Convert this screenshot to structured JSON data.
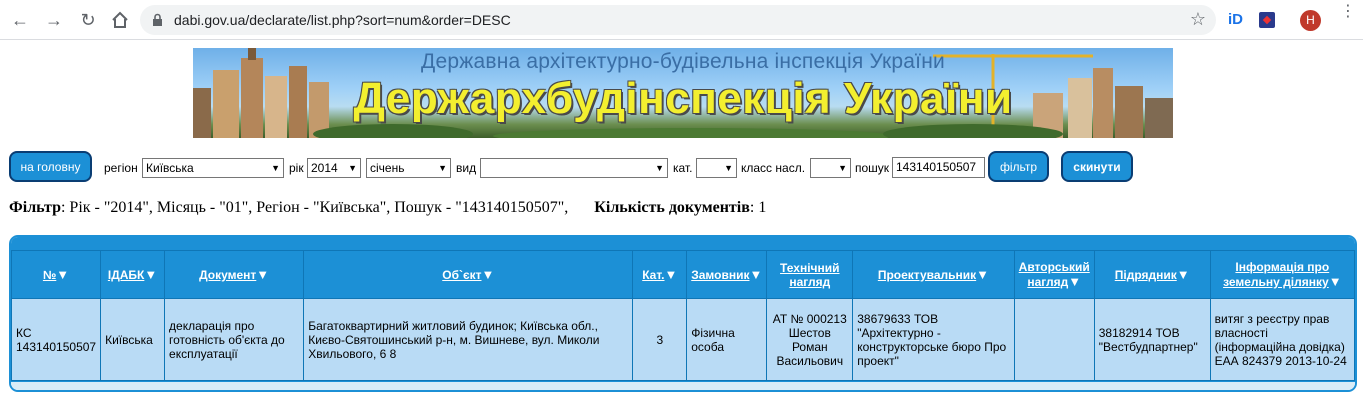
{
  "browser": {
    "url": "dabi.gov.ua/declarate/list.php?sort=num&order=DESC",
    "avatar_letter": "Н",
    "ext_label": "iD"
  },
  "banner": {
    "subtitle": "Державна архітектурно-будівельна інспекція України",
    "title": "Держархбудінспекція України"
  },
  "filters": {
    "home_button": "на головну",
    "region_label": "регіон",
    "region_value": "Київська",
    "year_label": "рік",
    "year_value": "2014",
    "month_value": "січень",
    "type_label": "вид",
    "type_value": "",
    "category_label": "кат.",
    "category_value": "",
    "class_label": "класс насл.",
    "class_value": "",
    "search_label": "пошук",
    "search_value": "143140150507",
    "filter_button": "фільтр",
    "reset_button": "скинути"
  },
  "summary": {
    "filter_label": "Фільтр",
    "filter_text": ": Рік - \"2014\", Місяць - \"01\", Регіон - \"Київська\", Пошук - \"143140150507\",",
    "count_label": "Кількість документів",
    "count_text": ": 1"
  },
  "table": {
    "columns": [
      {
        "label": "№",
        "sort": true
      },
      {
        "label": "ІДАБК",
        "sort": true
      },
      {
        "label": "Документ",
        "sort": true
      },
      {
        "label": "Об`єкт",
        "sort": true
      },
      {
        "label": "Кат.",
        "sort": true
      },
      {
        "label": "Замовник",
        "sort": true
      },
      {
        "label": "Технічний нагляд",
        "sort": false
      },
      {
        "label": "Проектувальник",
        "sort": true
      },
      {
        "label": "Авторський нагляд",
        "sort": true
      },
      {
        "label": "Підрядник",
        "sort": true
      },
      {
        "label": "Інформація про земельну ділянку",
        "sort": true
      }
    ],
    "rows": [
      [
        "КС 143140150507",
        "Київська",
        "декларація про готовність об'єкта до експлуатації",
        "Багатоквартирний житловий будинок; Київська обл., Києво-Святошинський р-н, м. Вишневе, вул. Миколи Хвильового, 6 8",
        "3",
        "Фізична особа",
        "АТ № 000213 Шестов Роман Васильович",
        "38679633 ТОВ \"Архітектурно - конструкторське бюро Про проект\"",
        "",
        "38182914 ТОВ \"Вестбудпартнер\"",
        "витяг з реєстру прав власності (інформаційна довідка) ЕАА 824379 2013-10-24"
      ]
    ]
  },
  "colors": {
    "accent": "#1c90d6",
    "cell_bg": "#b9dbf5",
    "banner_title": "#f3ef2f"
  }
}
